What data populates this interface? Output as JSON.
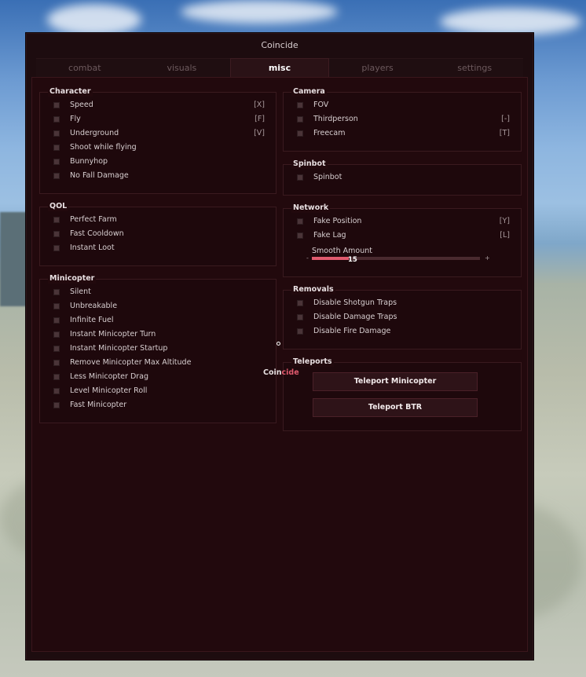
{
  "window": {
    "title": "Coincide"
  },
  "tabs": [
    {
      "label": "combat",
      "active": false
    },
    {
      "label": "visuals",
      "active": false
    },
    {
      "label": "misc",
      "active": true
    },
    {
      "label": "players",
      "active": false
    },
    {
      "label": "settings",
      "active": false
    }
  ],
  "groups": {
    "character": {
      "title": "Character",
      "items": [
        {
          "label": "Speed",
          "key": "[X]"
        },
        {
          "label": "Fly",
          "key": "[F]"
        },
        {
          "label": "Underground",
          "key": "[V]"
        },
        {
          "label": "Shoot while flying",
          "key": ""
        },
        {
          "label": "Bunnyhop",
          "key": ""
        },
        {
          "label": "No Fall Damage",
          "key": ""
        }
      ]
    },
    "qol": {
      "title": "QOL",
      "items": [
        {
          "label": "Perfect Farm"
        },
        {
          "label": "Fast Cooldown"
        },
        {
          "label": "Instant Loot"
        }
      ]
    },
    "minicopter": {
      "title": "Minicopter",
      "items": [
        {
          "label": "Silent"
        },
        {
          "label": "Unbreakable"
        },
        {
          "label": "Infinite Fuel"
        },
        {
          "label": "Instant Minicopter Turn"
        },
        {
          "label": "Instant Minicopter Startup"
        },
        {
          "label": "Remove Minicopter Max Altitude"
        },
        {
          "label": "Less Minicopter Drag"
        },
        {
          "label": "Level Minicopter Roll"
        },
        {
          "label": "Fast Minicopter"
        }
      ]
    },
    "camera": {
      "title": "Camera",
      "items": [
        {
          "label": "FOV",
          "key": ""
        },
        {
          "label": "Thirdperson",
          "key": "[-]"
        },
        {
          "label": "Freecam",
          "key": "[T]"
        }
      ]
    },
    "spinbot": {
      "title": "Spinbot",
      "items": [
        {
          "label": "Spinbot"
        }
      ]
    },
    "network": {
      "title": "Network",
      "items": [
        {
          "label": "Fake Position",
          "key": "[Y]"
        },
        {
          "label": "Fake Lag",
          "key": "[L]"
        }
      ],
      "slider": {
        "label": "Smooth Amount",
        "value": "15",
        "minus": "-",
        "plus": "+",
        "fill_fraction": 0.22
      }
    },
    "removals": {
      "title": "Removals",
      "items": [
        {
          "label": "Disable Shotgun Traps"
        },
        {
          "label": "Disable Damage Traps"
        },
        {
          "label": "Disable Fire Damage"
        }
      ]
    },
    "teleports": {
      "title": "Teleports",
      "buttons": [
        {
          "label": "Teleport Minicopter"
        },
        {
          "label": "Teleport BTR"
        }
      ]
    }
  },
  "watermark": {
    "part1": "Coin",
    "part2": "cide"
  },
  "colors": {
    "accent": "#e05a6e",
    "background": "#1d0c0f"
  }
}
